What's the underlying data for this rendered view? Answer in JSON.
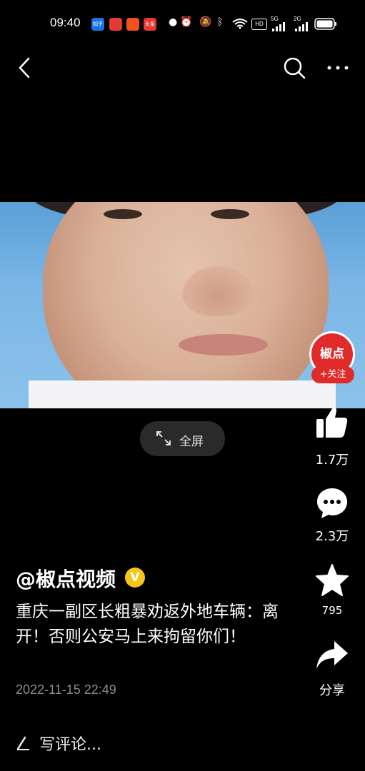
{
  "status_bar": {
    "time": "09:40",
    "apps": [
      {
        "name": "zhihu-app-icon",
        "label": "知乎",
        "color": "#1a73e8"
      },
      {
        "name": "red-app-icon",
        "label": "",
        "color": "#e53935"
      },
      {
        "name": "reader-app-icon",
        "label": "",
        "color": "#f4511e"
      },
      {
        "name": "toutiao-app-icon",
        "label": "头条",
        "color": "#e53935"
      }
    ],
    "network_badges": [
      "HD",
      "5G",
      "2G"
    ]
  },
  "badge": {
    "logo_text": "椒点",
    "follow_label": "+关注",
    "color": "#e12a2a"
  },
  "fullscreen": {
    "label": "全屏"
  },
  "actions": {
    "likes": "1.7万",
    "comments": "2.3万",
    "favorites": "795",
    "share": "分享"
  },
  "post": {
    "author": "@椒点视频",
    "verified_mark": "V",
    "title": "重庆一副区长粗暴劝返外地车辆：离开！否则公安马上来拘留你们！",
    "date": "2022-11-15 22:49"
  },
  "comment": {
    "placeholder": "写评论..."
  }
}
